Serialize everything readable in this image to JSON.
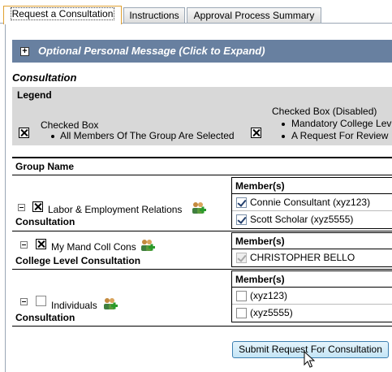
{
  "tabs": [
    {
      "label": "Request a Consultation",
      "active": true
    },
    {
      "label": "Instructions",
      "active": false
    },
    {
      "label": "Approval Process Summary",
      "active": false
    }
  ],
  "personal_message": {
    "label": "Optional Personal Message (Click to Expand)",
    "expand_symbol": "+"
  },
  "section_title": "Consultation",
  "legend": {
    "title": "Legend",
    "items": [
      {
        "title": "Checked Box",
        "bullets": [
          "All Members Of The Group Are Selected"
        ]
      },
      {
        "title": "Checked Box (Disabled)",
        "bullets": [
          "Mandatory College Lev",
          "A Request For Review"
        ]
      }
    ]
  },
  "group_name_header": "Group Name",
  "members_header": "Member(s)",
  "groups": [
    {
      "name": "Labor & Employment Relations",
      "type": "Consultation",
      "members": [
        {
          "label": "Connie Consultant (xyz123)",
          "checked": true,
          "disabled": false
        },
        {
          "label": "Scott Scholar (xyz5555)",
          "checked": true,
          "disabled": false
        }
      ]
    },
    {
      "name": "My Mand Coll Cons",
      "type": "College Level Consultation",
      "members": [
        {
          "label": "CHRISTOPHER BELLO",
          "checked": true,
          "disabled": true
        }
      ]
    },
    {
      "name": "Individuals",
      "type": "Consultation",
      "members": [
        {
          "label": "(xyz123)",
          "checked": false,
          "disabled": false
        },
        {
          "label": "(xyz5555)",
          "checked": false,
          "disabled": false
        }
      ]
    }
  ],
  "submit_label": "Submit Request For Consultation",
  "colors": {
    "header_bar": "#6880a0",
    "legend_bg": "#d8d8d8",
    "active_tab_border": "#e0a030",
    "button_border": "#3c7fb1"
  }
}
